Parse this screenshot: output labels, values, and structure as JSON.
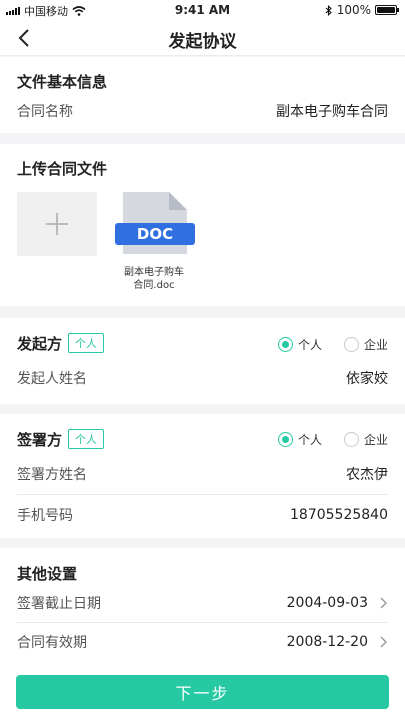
{
  "status_bar": {
    "carrier": "中国移动",
    "time": "9:41 AM",
    "battery": "100%",
    "battery_level": 1.0
  },
  "nav": {
    "title": "发起协议"
  },
  "basic_info": {
    "title": "文件基本信息",
    "contract_name_label": "合同名称",
    "contract_name_value": "副本电子购车合同"
  },
  "upload": {
    "title": "上传合同文件",
    "file_type": "DOC",
    "file_name_line1": "副本电子购车",
    "file_name_line2": "合同.doc"
  },
  "initiator": {
    "title": "发起方",
    "tag": "个人",
    "options": [
      "个人",
      "企业"
    ],
    "selected": "个人",
    "name_label": "发起人姓名",
    "name_value": "依家姣"
  },
  "signer": {
    "title": "签署方",
    "tag": "个人",
    "options": [
      "个人",
      "企业"
    ],
    "selected": "个人",
    "name_label": "签署方姓名",
    "name_value": "农杰伊",
    "phone_label": "手机号码",
    "phone_value": "18705525840"
  },
  "other": {
    "title": "其他设置",
    "deadline_label": "签署截止日期",
    "deadline_value": "2004-09-03",
    "validity_label": "合同有效期",
    "validity_value": "2008-12-20"
  },
  "footer": {
    "next_label": "下一步"
  },
  "colors": {
    "accent": "#27c9a2",
    "doc_blue": "#2f6fe0"
  },
  "icons": [
    "back-arrow-icon",
    "wifi-icon",
    "bluetooth-icon",
    "battery-icon",
    "plus-icon",
    "doc-file-icon",
    "chevron-right-icon"
  ]
}
